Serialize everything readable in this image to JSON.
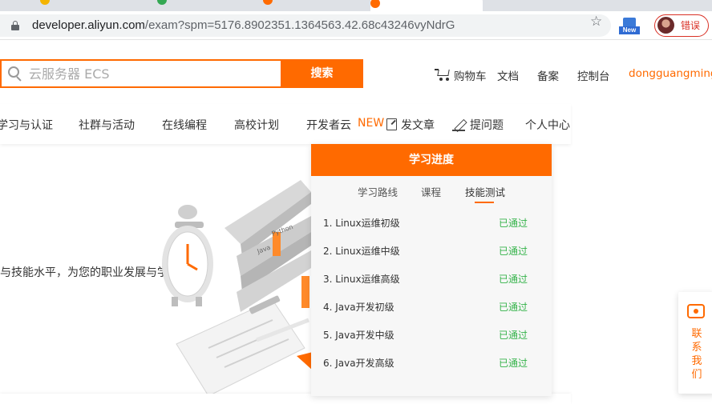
{
  "browser": {
    "url_domain": "developer.aliyun.com",
    "url_path": "/exam?spm=5176.8902351.1364563.42.68c43246vyNdrG",
    "ext_badge": "New",
    "error_label": "错误",
    "tab_colors": [
      "#f4b400",
      "#34a853",
      "#ff6a00",
      "#ff6a00"
    ]
  },
  "header": {
    "search_placeholder": "云服务器 ECS",
    "search_button": "搜索",
    "cart": "购物车",
    "docs": "文档",
    "filing": "备案",
    "console": "控制台",
    "username": "dongguangming*"
  },
  "nav": {
    "items": [
      "学习与认证",
      "社群与活动",
      "在线编程",
      "高校计划",
      "开发者云"
    ],
    "new_badge": "NEW",
    "write_article": "发文章",
    "ask_question": "提问题",
    "personal_center": "个人中心"
  },
  "hero": {
    "text": "与技能水平，为您的职业发展与学习指"
  },
  "progress": {
    "title": "学习进度",
    "tabs": [
      "学习路线",
      "课程",
      "技能测试"
    ],
    "active_tab": "技能测试",
    "levels": [
      {
        "name": "1. Linux运维初级",
        "status": "已通过"
      },
      {
        "name": "2. Linux运维中级",
        "status": "已通过"
      },
      {
        "name": "3. Linux运维高级",
        "status": "已通过"
      },
      {
        "name": "4. Java开发初级",
        "status": "已通过"
      },
      {
        "name": "5. Java开发中级",
        "status": "已通过"
      },
      {
        "name": "6. Java开发高级",
        "status": "已通过"
      }
    ]
  },
  "contact": {
    "label": "联系我们"
  },
  "colors": {
    "accent": "#ff6a00",
    "success": "#35b34a"
  }
}
